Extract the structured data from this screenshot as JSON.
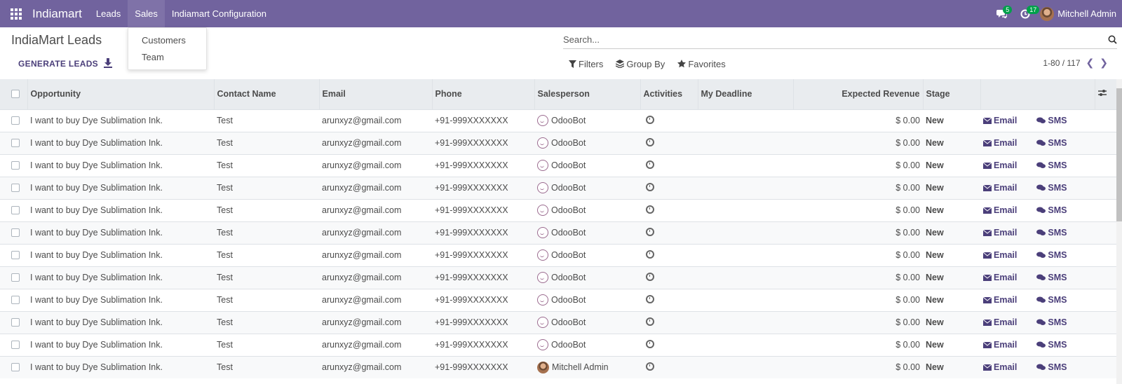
{
  "navbar": {
    "brand": "Indiamart",
    "menu": [
      {
        "label": "Leads"
      },
      {
        "label": "Sales"
      },
      {
        "label": "Indiamart Configuration"
      }
    ],
    "messages_count": "5",
    "activities_count": "17",
    "user_name": "Mitchell Admin",
    "color": "#71639e"
  },
  "sales_dropdown": {
    "items": [
      "Customers",
      "Team"
    ]
  },
  "control_panel": {
    "title": "IndiaMart Leads",
    "generate_label": "GENERATE LEADS",
    "search_placeholder": "Search...",
    "filters_label": "Filters",
    "groupby_label": "Group By",
    "favorites_label": "Favorites",
    "pager_value": "1-80 / 117"
  },
  "table": {
    "columns": [
      "Opportunity",
      "Contact Name",
      "Email",
      "Phone",
      "Salesperson",
      "Activities",
      "My Deadline",
      "Expected Revenue",
      "Stage"
    ],
    "rows": [
      {
        "opportunity": "I want to buy Dye Sublimation Ink.",
        "contact": "Test",
        "email": "arunxyz@gmail.com",
        "phone": "+91-999XXXXXXX",
        "salesperson": "OdooBot",
        "sp_icon": "bot",
        "revenue": "$ 0.00",
        "stage": "New"
      },
      {
        "opportunity": "I want to buy Dye Sublimation Ink.",
        "contact": "Test",
        "email": "arunxyz@gmail.com",
        "phone": "+91-999XXXXXXX",
        "salesperson": "OdooBot",
        "sp_icon": "bot",
        "revenue": "$ 0.00",
        "stage": "New"
      },
      {
        "opportunity": "I want to buy Dye Sublimation Ink.",
        "contact": "Test",
        "email": "arunxyz@gmail.com",
        "phone": "+91-999XXXXXXX",
        "salesperson": "OdooBot",
        "sp_icon": "bot",
        "revenue": "$ 0.00",
        "stage": "New"
      },
      {
        "opportunity": "I want to buy Dye Sublimation Ink.",
        "contact": "Test",
        "email": "arunxyz@gmail.com",
        "phone": "+91-999XXXXXXX",
        "salesperson": "OdooBot",
        "sp_icon": "bot",
        "revenue": "$ 0.00",
        "stage": "New"
      },
      {
        "opportunity": "I want to buy Dye Sublimation Ink.",
        "contact": "Test",
        "email": "arunxyz@gmail.com",
        "phone": "+91-999XXXXXXX",
        "salesperson": "OdooBot",
        "sp_icon": "bot",
        "revenue": "$ 0.00",
        "stage": "New"
      },
      {
        "opportunity": "I want to buy Dye Sublimation Ink.",
        "contact": "Test",
        "email": "arunxyz@gmail.com",
        "phone": "+91-999XXXXXXX",
        "salesperson": "OdooBot",
        "sp_icon": "bot",
        "revenue": "$ 0.00",
        "stage": "New"
      },
      {
        "opportunity": "I want to buy Dye Sublimation Ink.",
        "contact": "Test",
        "email": "arunxyz@gmail.com",
        "phone": "+91-999XXXXXXX",
        "salesperson": "OdooBot",
        "sp_icon": "bot",
        "revenue": "$ 0.00",
        "stage": "New"
      },
      {
        "opportunity": "I want to buy Dye Sublimation Ink.",
        "contact": "Test",
        "email": "arunxyz@gmail.com",
        "phone": "+91-999XXXXXXX",
        "salesperson": "OdooBot",
        "sp_icon": "bot",
        "revenue": "$ 0.00",
        "stage": "New"
      },
      {
        "opportunity": "I want to buy Dye Sublimation Ink.",
        "contact": "Test",
        "email": "arunxyz@gmail.com",
        "phone": "+91-999XXXXXXX",
        "salesperson": "OdooBot",
        "sp_icon": "bot",
        "revenue": "$ 0.00",
        "stage": "New"
      },
      {
        "opportunity": "I want to buy Dye Sublimation Ink.",
        "contact": "Test",
        "email": "arunxyz@gmail.com",
        "phone": "+91-999XXXXXXX",
        "salesperson": "OdooBot",
        "sp_icon": "bot",
        "revenue": "$ 0.00",
        "stage": "New"
      },
      {
        "opportunity": "I want to buy Dye Sublimation Ink.",
        "contact": "Test",
        "email": "arunxyz@gmail.com",
        "phone": "+91-999XXXXXXX",
        "salesperson": "OdooBot",
        "sp_icon": "bot",
        "revenue": "$ 0.00",
        "stage": "New"
      },
      {
        "opportunity": "I want to buy Dye Sublimation Ink.",
        "contact": "Test",
        "email": "arunxyz@gmail.com",
        "phone": "+91-999XXXXXXX",
        "salesperson": "Mitchell Admin",
        "sp_icon": "user",
        "revenue": "$ 0.00",
        "stage": "New"
      }
    ],
    "email_action": "Email",
    "sms_action": "SMS"
  }
}
